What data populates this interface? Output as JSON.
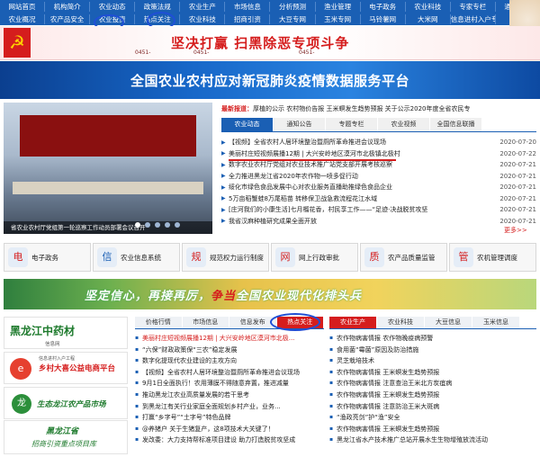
{
  "nav": {
    "row1": [
      "网站首页",
      "机构简介",
      "农业动态",
      "政策法规",
      "农业生产",
      "市场信息",
      "分析预测",
      "渔业管理",
      "电子政务",
      "农业科技",
      "专家专栏",
      "通知公告"
    ],
    "row2": [
      "农业概况",
      "农产品安全",
      "农业投资",
      "热点关注",
      "农业科技",
      "招商引资",
      "大豆专网",
      "玉米专网",
      "马铃薯网",
      "大米网",
      "信息进村入户专栏",
      ""
    ]
  },
  "banner1": {
    "emblem": "☭",
    "slogan": "坚决打赢 扫黑除恶专项斗争",
    "phone_left": "0451-",
    "phone_mid": "0451-",
    "phone_right": "0451-"
  },
  "banner2": {
    "title": "全国农业农村应对新冠肺炎疫情数据服务平台"
  },
  "photo": {
    "screen_text": "",
    "caption": "省农业农村厅党组第一轮巡察工作动员部署会议召开"
  },
  "hot": {
    "label": "最新报道：",
    "text": "厚植的公示 农村物价告报 王米螟发生趋势预报 关于公示2020年度全省农民专"
  },
  "tabs": [
    "农业动态",
    "通知公告",
    "专题专栏",
    "农业视频",
    "全国信息联播"
  ],
  "news": [
    {
      "title": "【视频】全省农村人居环境整治暨厕所革命推进会议现场",
      "date": "2020-07-20"
    },
    {
      "title": "美丽村庄短视频展播12期 | 大兴安岭地区漠河市北极镇北极村",
      "date": "2020-07-22"
    },
    {
      "title": "数字农业农村厅党组对农业技术推广站党支部开展考核巡察",
      "date": "2020-07-21"
    },
    {
      "title": "全力推进黑龙江省2020年农作物一喷多促行动",
      "date": "2020-07-21"
    },
    {
      "title": "绥化市绿色食品发展中心对农业服务直播助推绿色食品企业",
      "date": "2020-07-21"
    },
    {
      "title": "5万亩稻蟹蛙8万尾稻苗 转移保卫战急救流程花江水域",
      "date": "2020-07-21"
    },
    {
      "title": "[庄河我们的小康生活]七月榴花香，村民享工作——“足迹·决战脱贫攻坚",
      "date": "2020-07-21"
    },
    {
      "title": "我省汉麻种植研究成果全面开放",
      "date": "2020-07-21"
    }
  ],
  "more": "更多>>",
  "services": [
    {
      "icon": "电",
      "label": "电子政务"
    },
    {
      "icon": "信",
      "label": "农业信息系统"
    },
    {
      "icon": "规",
      "label": "规范权力运行制度"
    },
    {
      "icon": "网",
      "label": "网上行政审批"
    },
    {
      "icon": "质",
      "label": "农产品质量监管"
    },
    {
      "icon": "管",
      "label": "农机管理调度"
    }
  ],
  "banner3": {
    "title_part1": "坚定信心，再接再厉，",
    "title_part2": "争当",
    "title_part3": "全国农业现代化排头兵"
  },
  "promos": {
    "p1_title": "黑龙江中药材",
    "p1_sub": "信息网",
    "p2_top": "信息进村入户工程",
    "p2_title": "乡村大喜公益电商平台",
    "p3_title": "生态龙江农产品市场",
    "p4_title": "黑龙江省",
    "p4_sub": "招商引资重点项目库"
  },
  "mid_tabs": [
    "价格行情",
    "市场信息",
    "信息发布",
    "热点关注"
  ],
  "right_tabs": [
    "农业生产",
    "农业科技",
    "大豆信息",
    "玉米信息"
  ],
  "mid_list": [
    "美丽村庄短视频展播12期 | 大兴安岭地区漠河市北极...",
    "“六保”财政政策保“三农”稳定发展",
    "数字化提现代农业建设的主攻方向",
    "【视频】全省农村人居环境整治暨厕所革命推进会议现场",
    "9月1日全面执行！农用薄膜不得随意弃置，推进减量",
    "推动黑龙江农业高质量发展的若干思考",
    "到黑龙江有关行业家庭全面规划乡村产业，业务...",
    "打赢“乡字号”“土字号”特色品牌",
    "@养猪户 关于生猪复产，这8项技术大关键了！",
    "发改委：大力支持帮标准项目建设 助力打造脱贫攻坚成"
  ],
  "right_list": [
    "农作物病害情报 农作物晚疫病预警",
    "食用菌“霉菌”原因及防治措施",
    "灵芝栽培技术",
    "农作物病害情报 王米螟发生趋势预报",
    "农作物病害情报 注意查治王米北方炭疽病",
    "农作物病害情报 王米螟发生趋势预报",
    "农作物病害情报 注意防治王米大斑病",
    "“渔政亮剑”护“渔”安全",
    "农作物病害情报 王米螟发生趋势预报",
    "黑龙江省水产技术推广总站开展水生生物增殖放流活动"
  ]
}
